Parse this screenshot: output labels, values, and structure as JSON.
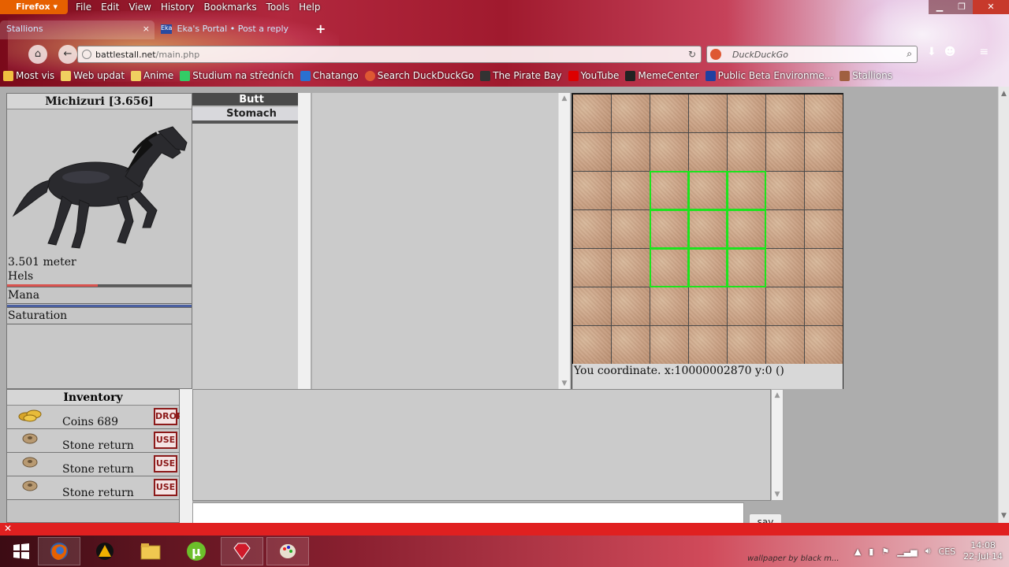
{
  "browser": {
    "app_button": "Firefox",
    "menu": [
      "File",
      "Edit",
      "View",
      "History",
      "Bookmarks",
      "Tools",
      "Help"
    ],
    "tabs": [
      {
        "label": "Stallions",
        "active": true
      },
      {
        "label": "Eka's Portal • Post a reply",
        "favicon": "Eka",
        "active": false
      }
    ],
    "url_host": "battlestall.net",
    "url_path": "/main.php",
    "search_placeholder": "DuckDuckGo",
    "bookmarks": [
      {
        "label": "Most vis",
        "color": "#f0c040"
      },
      {
        "label": "Web updat",
        "color": "#f0d060"
      },
      {
        "label": "Anime",
        "color": "#f0d060"
      },
      {
        "label": "Studium na středních",
        "color": "#3c6"
      },
      {
        "label": "Chatango",
        "color": "#2a70d0"
      },
      {
        "label": "Search DuckDuckGo",
        "color": "#de5833"
      },
      {
        "label": "The Pirate Bay",
        "color": "#333"
      },
      {
        "label": "YouTube",
        "color": "#d00"
      },
      {
        "label": "MemeCenter",
        "color": "#222"
      },
      {
        "label": "Public Beta Environme...",
        "color": "#2040a0"
      },
      {
        "label": "Stallions",
        "color": "#a06040"
      }
    ]
  },
  "character": {
    "name": "Michizuri [3.656]",
    "height": "3.501 meter",
    "health_label": "Hels",
    "health_fraction": 0.49,
    "health_color": "#d9534f",
    "mana_label": "Mana",
    "mana_fraction": 1.0,
    "mana_color": "#4a5fa0",
    "saturation_label": "Saturation"
  },
  "body_parts": [
    "Butt",
    "Stomach"
  ],
  "map": {
    "coordinate_text": "You coordinate. x:10000002870 y:0 ()",
    "highlight_color": "#1de41d"
  },
  "inventory": {
    "title": "Inventory",
    "items": [
      {
        "name": "Coins 689",
        "icon": "coins-icon",
        "action": "DROP"
      },
      {
        "name": "Stone return",
        "icon": "stone-icon",
        "action": "USE"
      },
      {
        "name": "Stone return",
        "icon": "stone-icon",
        "action": "USE"
      },
      {
        "name": "Stone return",
        "icon": "stone-icon",
        "action": "USE"
      }
    ]
  },
  "chat": {
    "say_label": "say"
  },
  "taskbar": {
    "language": "CES",
    "time": "14:08",
    "date": "22-Jul-14",
    "wallpaper_credit": "wallpaper by black m..."
  }
}
